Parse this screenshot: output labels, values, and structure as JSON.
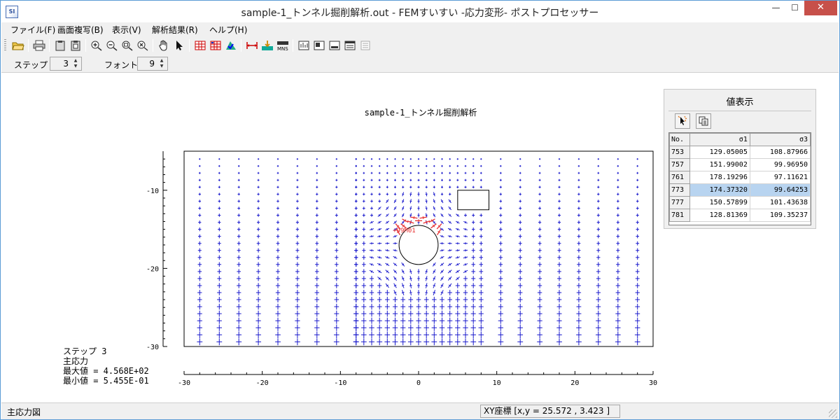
{
  "window": {
    "title": "sample-1_トンネル掘削解析.out - FEMすいすい -応力変形- ポストプロセッサー",
    "app_icon_text": "SI",
    "minimize_glyph": "—",
    "maximize_glyph": "☐",
    "close_glyph": "✕"
  },
  "menu": {
    "items": [
      {
        "label": "ファイル(F)"
      },
      {
        "label": "画面複写(B)"
      },
      {
        "label": "表示(V)"
      },
      {
        "label": "解析結果(R)"
      },
      {
        "label": "ヘルプ(H)"
      }
    ]
  },
  "toolbar": {
    "icons": [
      "open-folder-icon",
      "print-icon",
      "copy-icon",
      "paste-icon",
      "zoom-in-icon",
      "zoom-out-icon",
      "zoom-fit-icon",
      "zoom-window-icon",
      "hand-pan-icon",
      "pointer-icon",
      "mesh-icon",
      "mesh-number-icon",
      "contour-icon",
      "dimension-icon",
      "deform-icon",
      "mns-icon",
      "layout1-icon",
      "layout2-icon",
      "layout3-icon",
      "layout4-icon",
      "list-icon"
    ]
  },
  "params": {
    "step_label": "ステップ",
    "step_value": "3",
    "font_label": "フォント",
    "font_value": "9"
  },
  "plot": {
    "title": "sample-1_トンネル掘削解析",
    "annotation": "+99M01",
    "stats": {
      "step": "ステップ 3",
      "kind": "主応力",
      "max": "最大値 = 4.568E+02",
      "min": "最小値 = 5.455E-01"
    }
  },
  "chart_data": {
    "type": "scatter",
    "title": "sample-1_トンネル掘削解析",
    "xlabel": "",
    "ylabel": "",
    "xlim": [
      -30,
      30
    ],
    "ylim": [
      -30,
      -5
    ],
    "x_ticks": [
      -30,
      -20,
      -10,
      0,
      10,
      20,
      30
    ],
    "y_ticks": [
      -10,
      -20,
      -30
    ],
    "tunnel_circle": {
      "cx": 0,
      "cy": -17,
      "r": 2.5
    },
    "opening_rect": {
      "x0": 5,
      "x1": 9,
      "y0": -12.5,
      "y1": -10
    },
    "series": [
      {
        "name": "",
        "kind": "principal-stress-crosses",
        "color": "#1a1acc"
      }
    ]
  },
  "value_panel": {
    "title": "値表示",
    "headers": [
      "No.",
      "σ1",
      "σ3"
    ],
    "rows": [
      {
        "no": "753",
        "s1": "129.05005",
        "s3": "108.87966"
      },
      {
        "no": "757",
        "s1": "151.99002",
        "s3": "99.96950"
      },
      {
        "no": "761",
        "s1": "178.19296",
        "s3": "97.11621"
      },
      {
        "no": "773",
        "s1": "174.37320",
        "s3": "99.64253"
      },
      {
        "no": "777",
        "s1": "150.57899",
        "s3": "101.43638"
      },
      {
        "no": "781",
        "s1": "128.81369",
        "s3": "109.35237"
      }
    ],
    "selected_no": "773"
  },
  "status": {
    "left": "主応力図",
    "xy": "XY座標 [x,y  =  25.572 , 3.423 ]"
  },
  "colors": {
    "frame": "#5b9bd5",
    "close": "#c7504a",
    "chrome": "#f0f0f0",
    "stress": "#1a1acc",
    "peak": "#e83030",
    "selected": "#b8d4f0"
  }
}
